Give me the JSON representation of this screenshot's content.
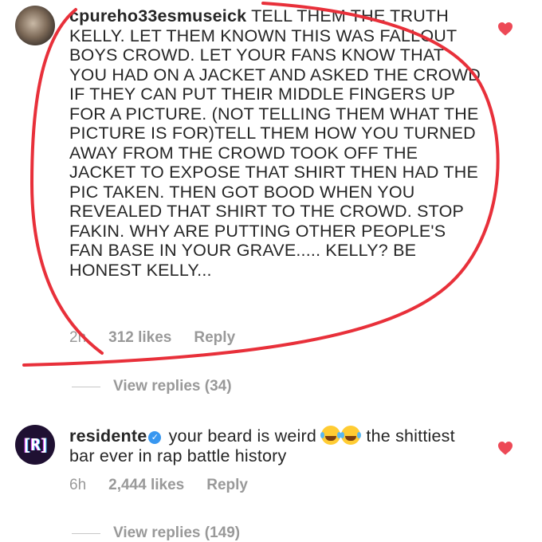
{
  "comments": [
    {
      "username": "cpureho33esmuseick",
      "text": "TELL THEM THE TRUTH KELLY. LET THEM KNOWN THIS WAS FALLOUT BOYS CROWD. LET YOUR FANS KNOW THAT YOU HAD ON A JACKET AND ASKED THE CROWD IF THEY CAN PUT THEIR MIDDLE FINGERS UP FOR A PICTURE. (NOT TELLING THEM WHAT THE PICTURE IS FOR)TELL THEM HOW YOU TURNED AWAY FROM THE CROWD TOOK OFF THE JACKET TO EXPOSE THAT SHIRT THEN HAD THE PIC TAKEN. THEN GOT BOOD WHEN YOU REVEALED THAT SHIRT TO THE CROWD. STOP FAKIN. WHY ARE PUTTING OTHER PEOPLE'S FAN BASE IN YOUR GRAVE..... KELLY? BE HONEST KELLY...",
      "time": "2h",
      "likes": "312 likes",
      "reply_label": "Reply",
      "view_replies": "View replies (34)",
      "liked": true,
      "avatar_icon": "user-photo-avatar"
    },
    {
      "username": "residente",
      "verified": true,
      "text_before": "your beard is weird",
      "emoji": "😂😂",
      "text_after": "the shittiest bar ever in rap battle history",
      "time": "6h",
      "likes": "2,444 likes",
      "reply_label": "Reply",
      "view_replies": "View replies (149)",
      "liked": true,
      "avatar_logo": "[R]"
    }
  ],
  "colors": {
    "heart": "#ed4956",
    "annotation": "#e8303a",
    "meta_text": "#999999",
    "verified": "#3897f0"
  },
  "icons": [
    "heart-icon",
    "verified-badge-icon"
  ]
}
